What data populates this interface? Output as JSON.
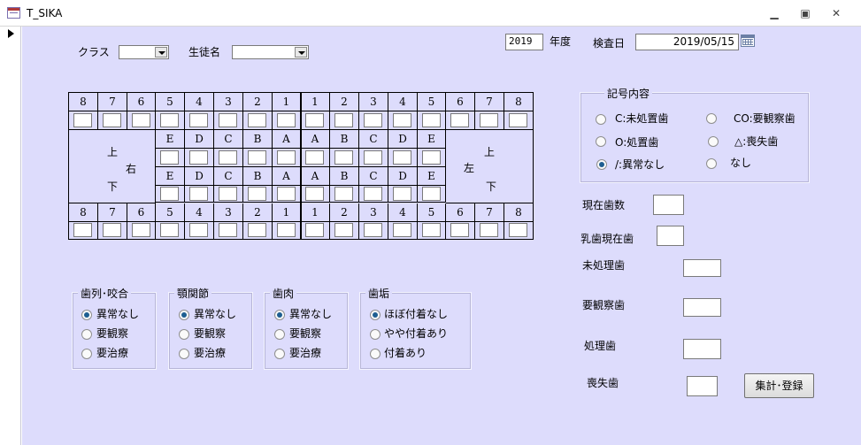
{
  "window": {
    "title": "T_SIKA"
  },
  "header": {
    "class_label": "クラス",
    "class_value": "",
    "student_label": "生徒名",
    "student_value": "",
    "year_value": "2019",
    "year_label": "年度",
    "date_label": "検査日",
    "date_value": "2019/05/15"
  },
  "chart": {
    "numbers": [
      "8",
      "7",
      "6",
      "5",
      "4",
      "3",
      "2",
      "1",
      "1",
      "2",
      "3",
      "4",
      "5",
      "6",
      "7",
      "8"
    ],
    "deciduous": [
      "E",
      "D",
      "C",
      "B",
      "A",
      "A",
      "B",
      "C",
      "D",
      "E"
    ],
    "upper_right": "上",
    "right": "右",
    "lower_right": "下",
    "upper_left": "上",
    "left": "左",
    "lower_left": "下"
  },
  "legend": {
    "title": "記号内容",
    "options": [
      "C:未処置歯",
      "CO:要観察歯",
      "O:処置歯",
      "△:喪失歯",
      "/:異常なし",
      "なし"
    ],
    "selected": "/:異常なし"
  },
  "counts": {
    "present_label": "現在歯数",
    "deciduous_label": "乳歯現在歯",
    "untreated_label": "未処理歯",
    "observe_label": "要観察歯",
    "treated_label": "処理歯",
    "lost_label": "喪失歯",
    "submit_label": "集計･登録"
  },
  "groups": [
    {
      "title": "歯列･咬合",
      "options": [
        "異常なし",
        "要観察",
        "要治療"
      ],
      "selected": "異常なし"
    },
    {
      "title": "顎関節",
      "options": [
        "異常なし",
        "要観察",
        "要治療"
      ],
      "selected": "異常なし"
    },
    {
      "title": "歯肉",
      "options": [
        "異常なし",
        "要観察",
        "要治療"
      ],
      "selected": "異常なし"
    },
    {
      "title": "歯垢",
      "options": [
        "ほぼ付着なし",
        "やや付着あり",
        "付着あり"
      ],
      "selected": "ほぼ付着なし"
    }
  ]
}
